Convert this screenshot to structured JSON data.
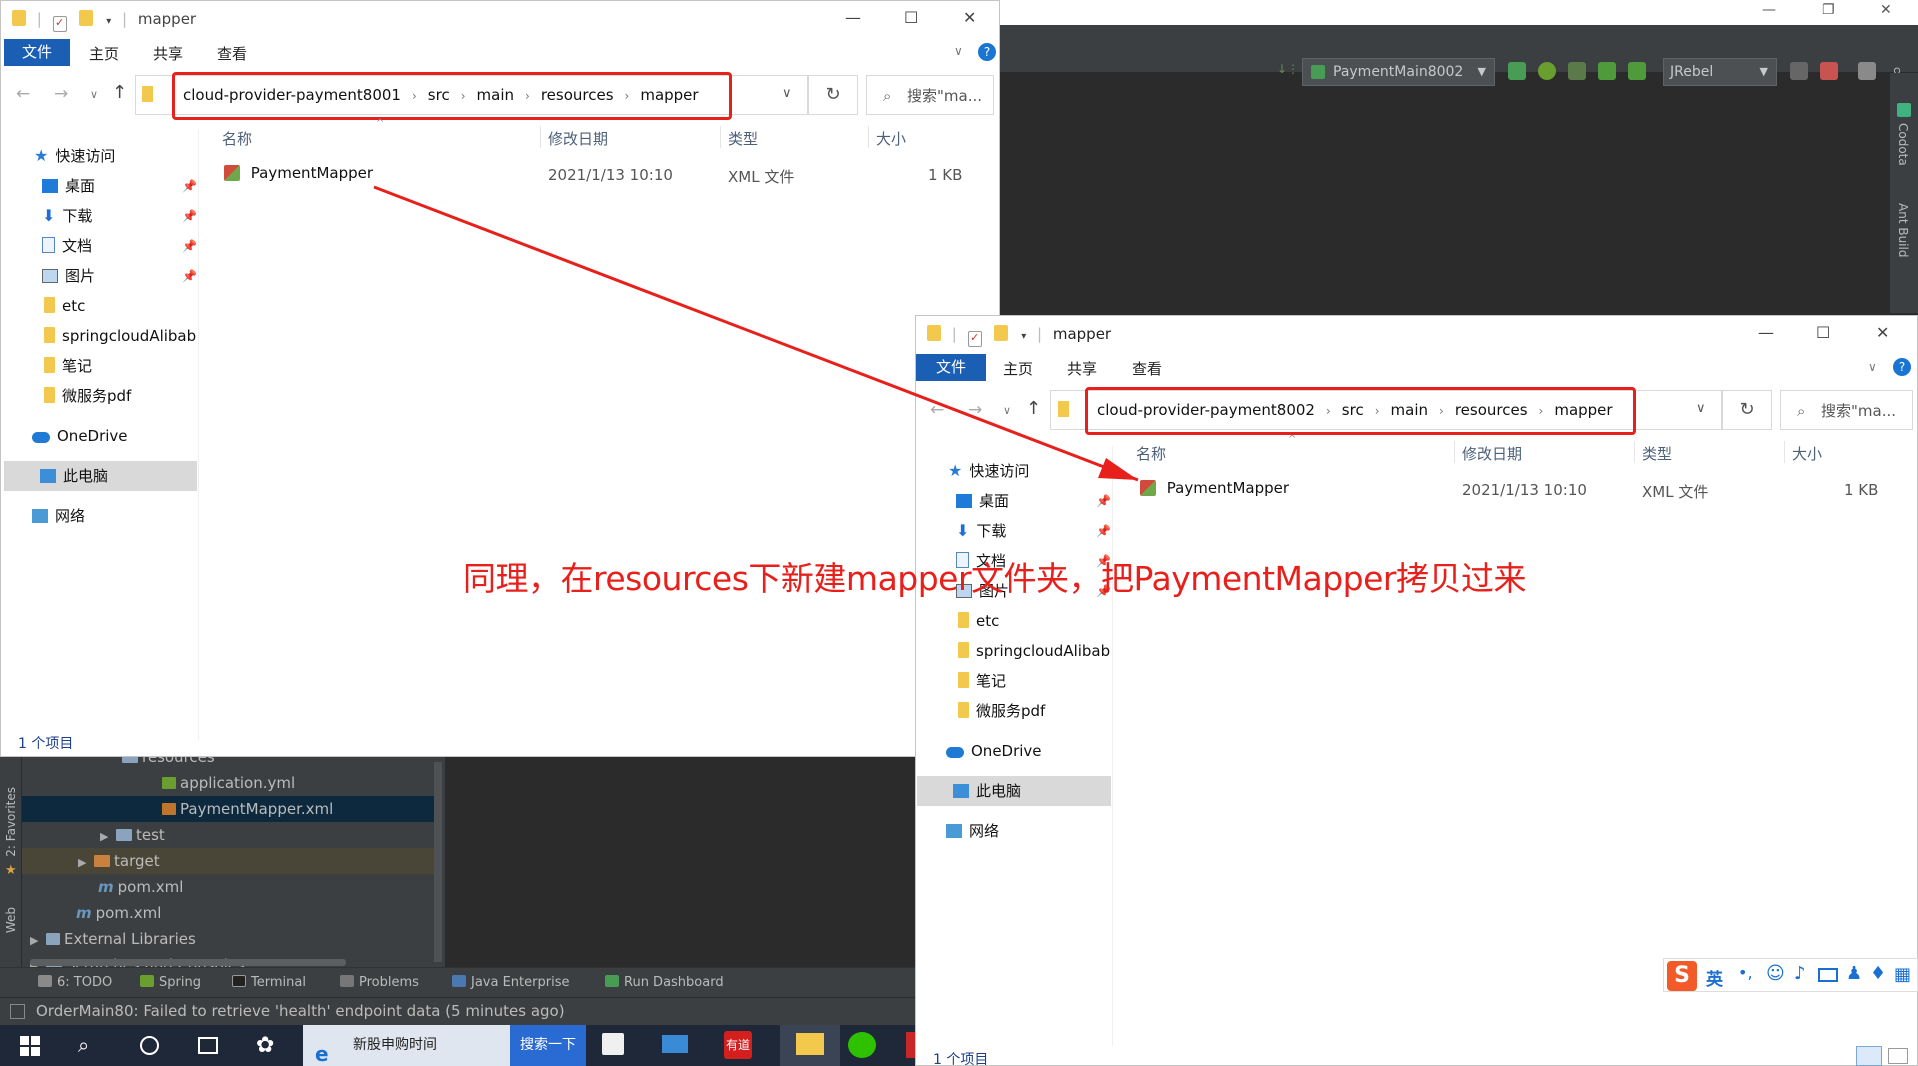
{
  "ide": {
    "run_config": "PaymentMain8002",
    "jrebel": "JRebel",
    "right_tools": [
      "Codota",
      "Ant Build"
    ],
    "left_tools": [
      "2: Favorites",
      "Web"
    ],
    "tree": [
      {
        "label": "resources",
        "kind": "folder"
      },
      {
        "label": "application.yml",
        "kind": "yml"
      },
      {
        "label": "PaymentMapper.xml",
        "kind": "xml",
        "selected": true
      },
      {
        "label": "test",
        "kind": "folder"
      },
      {
        "label": "target",
        "kind": "folder-orange"
      },
      {
        "label": "pom.xml",
        "kind": "maven"
      },
      {
        "label": "pom.xml",
        "kind": "maven"
      },
      {
        "label": "External Libraries",
        "kind": "lib"
      },
      {
        "label": "Scratches and Consoles",
        "kind": "scratch"
      }
    ],
    "tool_tabs": [
      "6: TODO",
      "Spring",
      "Terminal",
      "Problems",
      "Java Enterprise",
      "Run Dashboard"
    ],
    "status": "OrderMain80: Failed to retrieve 'health' endpoint data (5 minutes ago)"
  },
  "taskbar": {
    "search_text": "新股申购时间",
    "search_button": "搜索一下",
    "youdao": "有道"
  },
  "explorer1": {
    "title": "mapper",
    "ribbon": {
      "file": "文件",
      "tabs": [
        "主页",
        "共享",
        "查看"
      ]
    },
    "breadcrumb": [
      "cloud-provider-payment8001",
      "src",
      "main",
      "resources",
      "mapper"
    ],
    "search_placeholder": "搜索\"ma...",
    "columns": {
      "name": "名称",
      "date": "修改日期",
      "type": "类型",
      "size": "大小"
    },
    "files": [
      {
        "name": "PaymentMapper",
        "date": "2021/1/13 10:10",
        "type": "XML 文件",
        "size": "1 KB"
      }
    ],
    "nav": {
      "quick_access": "快速访问",
      "pinned": [
        "桌面",
        "下载",
        "文档",
        "图片"
      ],
      "folders": [
        "etc",
        "springcloudAlibab",
        "笔记",
        "微服务pdf"
      ],
      "onedrive": "OneDrive",
      "this_pc": "此电脑",
      "network": "网络"
    },
    "count": "1 个项目"
  },
  "explorer2": {
    "title": "mapper",
    "ribbon": {
      "file": "文件",
      "tabs": [
        "主页",
        "共享",
        "查看"
      ]
    },
    "breadcrumb": [
      "cloud-provider-payment8002",
      "src",
      "main",
      "resources",
      "mapper"
    ],
    "search_placeholder": "搜索\"ma...",
    "columns": {
      "name": "名称",
      "date": "修改日期",
      "type": "类型",
      "size": "大小"
    },
    "files": [
      {
        "name": "PaymentMapper",
        "date": "2021/1/13 10:10",
        "type": "XML 文件",
        "size": "1 KB"
      }
    ],
    "nav": {
      "quick_access": "快速访问",
      "pinned": [
        "桌面",
        "下载",
        "文档",
        "图片"
      ],
      "folders": [
        "etc",
        "springcloudAlibab",
        "笔记",
        "微服务pdf"
      ],
      "onedrive": "OneDrive",
      "this_pc": "此电脑",
      "network": "网络"
    },
    "count": "1 个项目"
  },
  "annotation": "同理，在resources下新建mapper文件夹，把PaymentMapper拷贝过来",
  "ime": {
    "lang": "英"
  },
  "colors": {
    "annotation_red": "#e8201b",
    "ribbon_blue": "#1a5fb4",
    "ide_dark": "#2b2b2b",
    "ide_panel": "#3c3f41"
  }
}
